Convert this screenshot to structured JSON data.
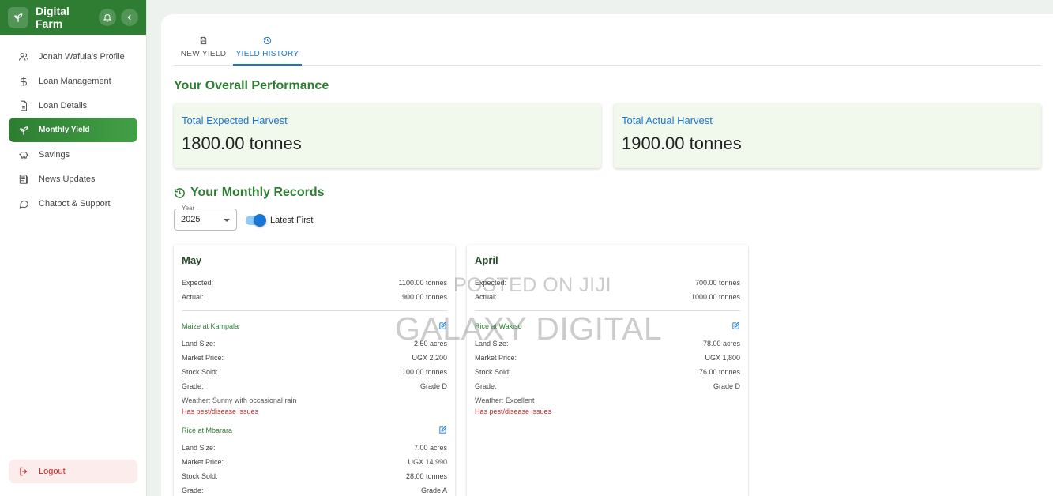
{
  "app": {
    "brand": "Digital Farm"
  },
  "sidebar": {
    "items": [
      {
        "label": "Jonah Wafula's Profile",
        "icon": "users-icon"
      },
      {
        "label": "Loan Management",
        "icon": "dollar-icon"
      },
      {
        "label": "Loan Details",
        "icon": "document-icon"
      },
      {
        "label": "Monthly Yield",
        "icon": "sprout-icon",
        "active": true
      },
      {
        "label": "Savings",
        "icon": "piggy-bank-icon"
      },
      {
        "label": "News Updates",
        "icon": "newspaper-icon"
      },
      {
        "label": "Chatbot & Support",
        "icon": "chat-icon"
      }
    ],
    "logout": "Logout"
  },
  "tabs": [
    {
      "label": "NEW YIELD",
      "icon": "save-icon"
    },
    {
      "label": "YIELD HISTORY",
      "icon": "history-icon",
      "active": true
    }
  ],
  "performance": {
    "title": "Your Overall Performance",
    "expected_label": "Total Expected Harvest",
    "expected_value": "1800.00 tonnes",
    "actual_label": "Total Actual Harvest",
    "actual_value": "1900.00 tonnes"
  },
  "records": {
    "title": "Your Monthly Records",
    "year_label": "Year",
    "year_value": "2025",
    "toggle_label": "Latest First",
    "toggle_on": true,
    "labels": {
      "expected": "Expected:",
      "actual": "Actual:",
      "land_size": "Land Size:",
      "market_price": "Market Price:",
      "stock_sold": "Stock Sold:",
      "grade": "Grade:"
    },
    "months": [
      {
        "month": "May",
        "expected": "1100.00 tonnes",
        "actual": "900.00 tonnes",
        "crops": [
          {
            "name": "Maize at Kampala",
            "land_size": "2.50 acres",
            "market_price": "UGX 2,200",
            "stock_sold": "100.00 tonnes",
            "grade": "Grade D",
            "weather": "Weather: Sunny with occasional rain",
            "pest": "Has pest/disease issues"
          },
          {
            "name": "Rice at Mbarara",
            "land_size": "7.00 acres",
            "market_price": "UGX 14,990",
            "stock_sold": "28.00 tonnes",
            "grade": "Grade A"
          }
        ]
      },
      {
        "month": "April",
        "expected": "700.00 tonnes",
        "actual": "1000.00 tonnes",
        "crops": [
          {
            "name": "Rice at Wakiso",
            "land_size": "78.00 acres",
            "market_price": "UGX 1,800",
            "stock_sold": "76.00 tonnes",
            "grade": "Grade D",
            "weather": "Weather: Excellent",
            "pest": "Has pest/disease issues"
          }
        ]
      }
    ]
  },
  "watermark": {
    "line1": "POSTED ON JIJI",
    "line2": "GALAXY DIGITAL"
  }
}
